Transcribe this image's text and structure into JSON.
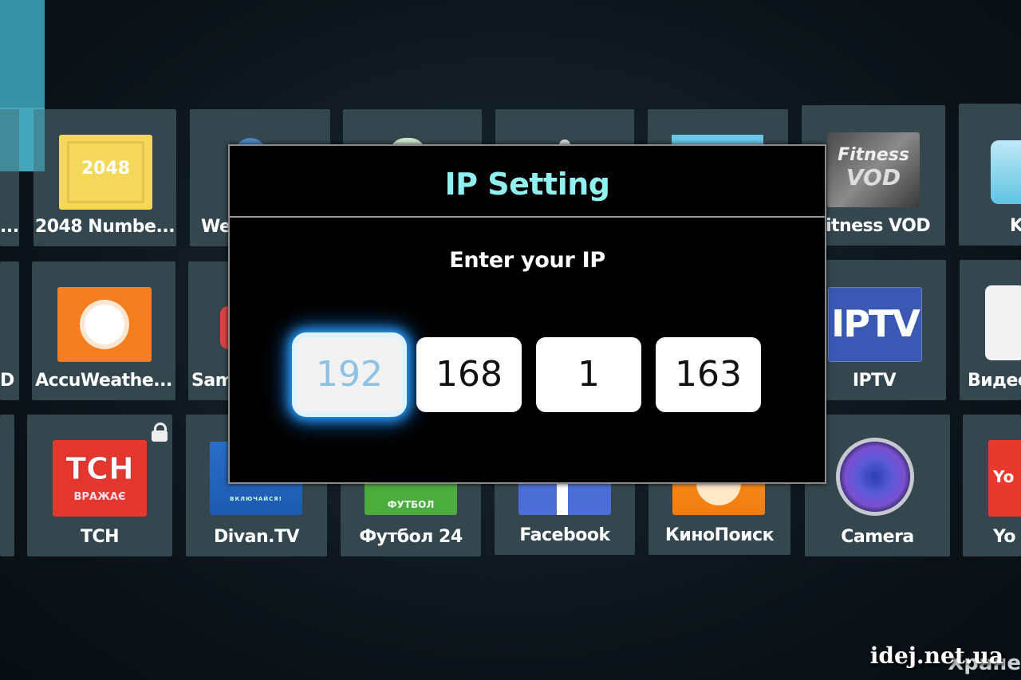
{
  "screen": "Samsung Smart Hub - apps grid",
  "apps": {
    "row1": [
      {
        "label": "..."
      },
      {
        "label": "2048 Numbe...",
        "icon_text": "2048"
      },
      {
        "label": "We"
      },
      {
        "label": ""
      },
      {
        "label": ""
      },
      {
        "label": ""
      },
      {
        "label": "itness VOD",
        "icon_text_1": "Fitness",
        "icon_text_2": "VOD"
      },
      {
        "label": "K"
      }
    ],
    "row2": [
      {
        "label": "D"
      },
      {
        "label": "AccuWeathe..."
      },
      {
        "label": "Sam"
      },
      {
        "label": "IPTV",
        "icon_text": "IPTV"
      },
      {
        "label": "Видео"
      }
    ],
    "row3": [
      {
        "label": "TCH",
        "icon_text": "TCH",
        "icon_sub": "ВРАЖАЄ",
        "locked": true
      },
      {
        "label": "Divan.TV",
        "icon_sub": "ВКЛЮЧАЙСЯ!"
      },
      {
        "label": "Футбол 24",
        "icon_sub": "ФУТБОЛ"
      },
      {
        "label": "Facebook"
      },
      {
        "label": "КиноПоиск"
      },
      {
        "label": "Camera"
      },
      {
        "label": "Yo",
        "icon_text": "Yo"
      }
    ]
  },
  "dialog": {
    "title": "IP Setting",
    "prompt": "Enter your IP",
    "octets": [
      "192",
      "168",
      "1",
      "163"
    ],
    "focused_octet": 0
  },
  "bottom_label": "Хранe",
  "watermark": "idej.net.ua",
  "colors": {
    "title": "#8ff0ef",
    "focus_glow": "#2aa0ff",
    "tile": "#34474f"
  }
}
